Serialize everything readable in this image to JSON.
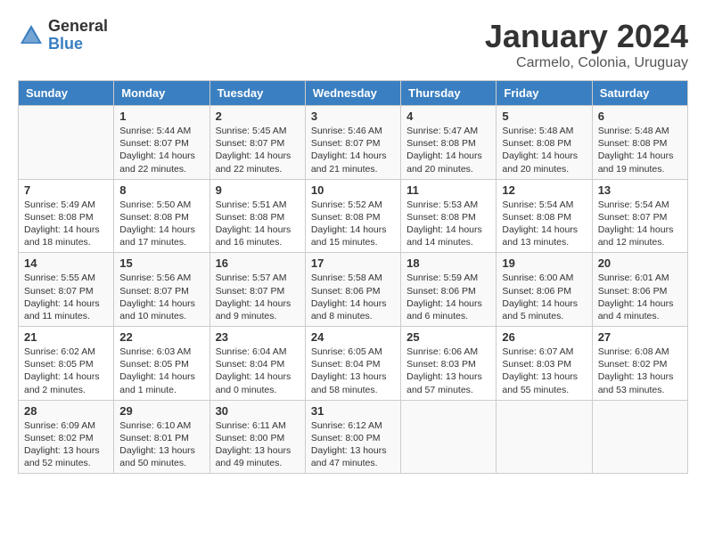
{
  "logo": {
    "general": "General",
    "blue": "Blue"
  },
  "title": "January 2024",
  "location": "Carmelo, Colonia, Uruguay",
  "days_of_week": [
    "Sunday",
    "Monday",
    "Tuesday",
    "Wednesday",
    "Thursday",
    "Friday",
    "Saturday"
  ],
  "weeks": [
    [
      {
        "day": "",
        "info": ""
      },
      {
        "day": "1",
        "info": "Sunrise: 5:44 AM\nSunset: 8:07 PM\nDaylight: 14 hours\nand 22 minutes."
      },
      {
        "day": "2",
        "info": "Sunrise: 5:45 AM\nSunset: 8:07 PM\nDaylight: 14 hours\nand 22 minutes."
      },
      {
        "day": "3",
        "info": "Sunrise: 5:46 AM\nSunset: 8:07 PM\nDaylight: 14 hours\nand 21 minutes."
      },
      {
        "day": "4",
        "info": "Sunrise: 5:47 AM\nSunset: 8:08 PM\nDaylight: 14 hours\nand 20 minutes."
      },
      {
        "day": "5",
        "info": "Sunrise: 5:48 AM\nSunset: 8:08 PM\nDaylight: 14 hours\nand 20 minutes."
      },
      {
        "day": "6",
        "info": "Sunrise: 5:48 AM\nSunset: 8:08 PM\nDaylight: 14 hours\nand 19 minutes."
      }
    ],
    [
      {
        "day": "7",
        "info": "Sunrise: 5:49 AM\nSunset: 8:08 PM\nDaylight: 14 hours\nand 18 minutes."
      },
      {
        "day": "8",
        "info": "Sunrise: 5:50 AM\nSunset: 8:08 PM\nDaylight: 14 hours\nand 17 minutes."
      },
      {
        "day": "9",
        "info": "Sunrise: 5:51 AM\nSunset: 8:08 PM\nDaylight: 14 hours\nand 16 minutes."
      },
      {
        "day": "10",
        "info": "Sunrise: 5:52 AM\nSunset: 8:08 PM\nDaylight: 14 hours\nand 15 minutes."
      },
      {
        "day": "11",
        "info": "Sunrise: 5:53 AM\nSunset: 8:08 PM\nDaylight: 14 hours\nand 14 minutes."
      },
      {
        "day": "12",
        "info": "Sunrise: 5:54 AM\nSunset: 8:08 PM\nDaylight: 14 hours\nand 13 minutes."
      },
      {
        "day": "13",
        "info": "Sunrise: 5:54 AM\nSunset: 8:07 PM\nDaylight: 14 hours\nand 12 minutes."
      }
    ],
    [
      {
        "day": "14",
        "info": "Sunrise: 5:55 AM\nSunset: 8:07 PM\nDaylight: 14 hours\nand 11 minutes."
      },
      {
        "day": "15",
        "info": "Sunrise: 5:56 AM\nSunset: 8:07 PM\nDaylight: 14 hours\nand 10 minutes."
      },
      {
        "day": "16",
        "info": "Sunrise: 5:57 AM\nSunset: 8:07 PM\nDaylight: 14 hours\nand 9 minutes."
      },
      {
        "day": "17",
        "info": "Sunrise: 5:58 AM\nSunset: 8:06 PM\nDaylight: 14 hours\nand 8 minutes."
      },
      {
        "day": "18",
        "info": "Sunrise: 5:59 AM\nSunset: 8:06 PM\nDaylight: 14 hours\nand 6 minutes."
      },
      {
        "day": "19",
        "info": "Sunrise: 6:00 AM\nSunset: 8:06 PM\nDaylight: 14 hours\nand 5 minutes."
      },
      {
        "day": "20",
        "info": "Sunrise: 6:01 AM\nSunset: 8:06 PM\nDaylight: 14 hours\nand 4 minutes."
      }
    ],
    [
      {
        "day": "21",
        "info": "Sunrise: 6:02 AM\nSunset: 8:05 PM\nDaylight: 14 hours\nand 2 minutes."
      },
      {
        "day": "22",
        "info": "Sunrise: 6:03 AM\nSunset: 8:05 PM\nDaylight: 14 hours\nand 1 minute."
      },
      {
        "day": "23",
        "info": "Sunrise: 6:04 AM\nSunset: 8:04 PM\nDaylight: 14 hours\nand 0 minutes."
      },
      {
        "day": "24",
        "info": "Sunrise: 6:05 AM\nSunset: 8:04 PM\nDaylight: 13 hours\nand 58 minutes."
      },
      {
        "day": "25",
        "info": "Sunrise: 6:06 AM\nSunset: 8:03 PM\nDaylight: 13 hours\nand 57 minutes."
      },
      {
        "day": "26",
        "info": "Sunrise: 6:07 AM\nSunset: 8:03 PM\nDaylight: 13 hours\nand 55 minutes."
      },
      {
        "day": "27",
        "info": "Sunrise: 6:08 AM\nSunset: 8:02 PM\nDaylight: 13 hours\nand 53 minutes."
      }
    ],
    [
      {
        "day": "28",
        "info": "Sunrise: 6:09 AM\nSunset: 8:02 PM\nDaylight: 13 hours\nand 52 minutes."
      },
      {
        "day": "29",
        "info": "Sunrise: 6:10 AM\nSunset: 8:01 PM\nDaylight: 13 hours\nand 50 minutes."
      },
      {
        "day": "30",
        "info": "Sunrise: 6:11 AM\nSunset: 8:00 PM\nDaylight: 13 hours\nand 49 minutes."
      },
      {
        "day": "31",
        "info": "Sunrise: 6:12 AM\nSunset: 8:00 PM\nDaylight: 13 hours\nand 47 minutes."
      },
      {
        "day": "",
        "info": ""
      },
      {
        "day": "",
        "info": ""
      },
      {
        "day": "",
        "info": ""
      }
    ]
  ]
}
